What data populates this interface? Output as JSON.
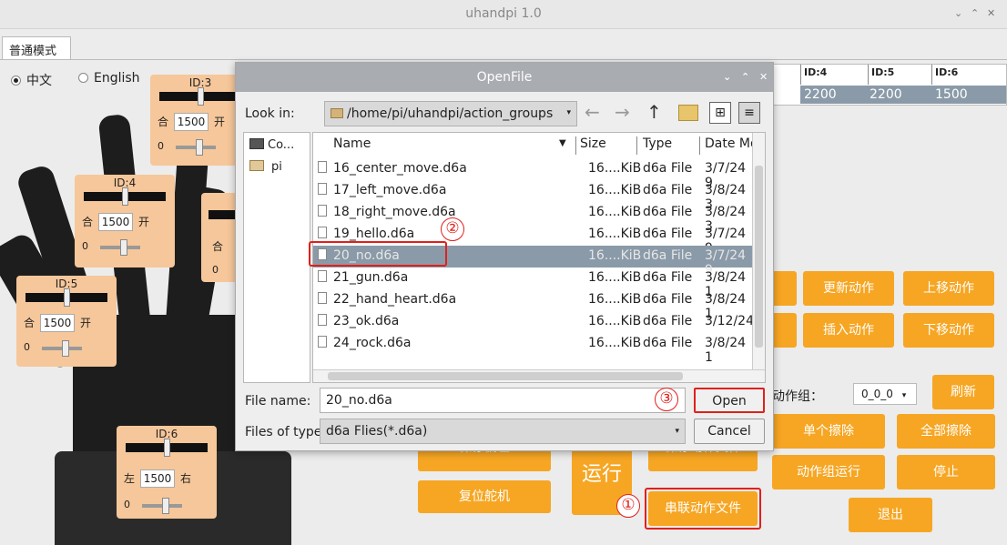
{
  "window": {
    "title": "uhandpi 1.0",
    "controls": [
      "⌄",
      "⌃",
      "✕"
    ]
  },
  "tab": {
    "label": "普通模式"
  },
  "language": {
    "options": [
      {
        "label": "中文",
        "selected": true
      },
      {
        "label": "English",
        "selected": false
      }
    ]
  },
  "servos": [
    {
      "id": "ID:3",
      "left": "合",
      "value": "1500",
      "right": "开",
      "min": "0"
    },
    {
      "id": "ID:4",
      "left": "合",
      "value": "1500",
      "right": "开",
      "min": "0"
    },
    {
      "id": "ID:5",
      "left": "合",
      "value": "1500",
      "right": "开",
      "min": "0"
    },
    {
      "id": "ID:6",
      "left": "左",
      "value": "1500",
      "right": "右",
      "min": "0"
    },
    {
      "id": "",
      "left": "合",
      "value": "",
      "right": "",
      "min": "0"
    }
  ],
  "table": {
    "headers": [
      "ID:4",
      "ID:5",
      "ID:6"
    ],
    "row": [
      "2200",
      "2200",
      "1500"
    ]
  },
  "buttons": {
    "update_action": "更新动作",
    "move_up": "上移动作",
    "insert_action": "插入动作",
    "move_down": "下移动作",
    "action_group_label": "动作组：",
    "action_group_value": "0_0_0",
    "refresh": "刷新",
    "erase_single": "单个擦除",
    "erase_all": "全部擦除",
    "save_deviation": "保存偏差",
    "save_action_file": "保存动作文件",
    "run": "运行",
    "run_group": "动作组运行",
    "stop": "停止",
    "reset_servo": "复位舵机",
    "chain_action_file": "串联动作文件",
    "exit": "退出"
  },
  "dialog": {
    "title": "OpenFile",
    "controls": [
      "⌄",
      "⌃",
      "✕"
    ],
    "look_in_label": "Look in:",
    "look_in_path": "/home/pi/uhandpi/action_groups",
    "sidebar": [
      {
        "label": "Co..."
      },
      {
        "label": "pi"
      }
    ],
    "columns": [
      "Name",
      "Size",
      "Type",
      "Date Mo"
    ],
    "files": [
      {
        "name": "16_center_move.d6a",
        "size": "16....KiB",
        "type": "d6a File",
        "date": "3/7/24 9"
      },
      {
        "name": "17_left_move.d6a",
        "size": "16....KiB",
        "type": "d6a File",
        "date": "3/8/24 3"
      },
      {
        "name": "18_right_move.d6a",
        "size": "16....KiB",
        "type": "d6a File",
        "date": "3/8/24 3"
      },
      {
        "name": "19_hello.d6a",
        "size": "16....KiB",
        "type": "d6a File",
        "date": "3/7/24 9"
      },
      {
        "name": "20_no.d6a",
        "size": "16....KiB",
        "type": "d6a File",
        "date": "3/7/24 9"
      },
      {
        "name": "21_gun.d6a",
        "size": "16....KiB",
        "type": "d6a File",
        "date": "3/8/24 1"
      },
      {
        "name": "22_hand_heart.d6a",
        "size": "16....KiB",
        "type": "d6a File",
        "date": "3/8/24 1"
      },
      {
        "name": "23_ok.d6a",
        "size": "16....KiB",
        "type": "d6a File",
        "date": "3/12/24"
      },
      {
        "name": "24_rock.d6a",
        "size": "16....KiB",
        "type": "d6a File",
        "date": "3/8/24 1"
      }
    ],
    "file_name_label": "File name:",
    "file_name_value": "20_no.d6a",
    "files_of_type_label": "Files of type:",
    "files_of_type_value": "d6a Flies(*.d6a)",
    "open_label": "Open",
    "cancel_label": "Cancel"
  },
  "annotations": {
    "step1": "①",
    "step2": "②",
    "step3": "③"
  },
  "colors": {
    "accent_orange": "#f6a623",
    "highlight_red": "#e0201b",
    "selection": "#8a9aa8"
  }
}
